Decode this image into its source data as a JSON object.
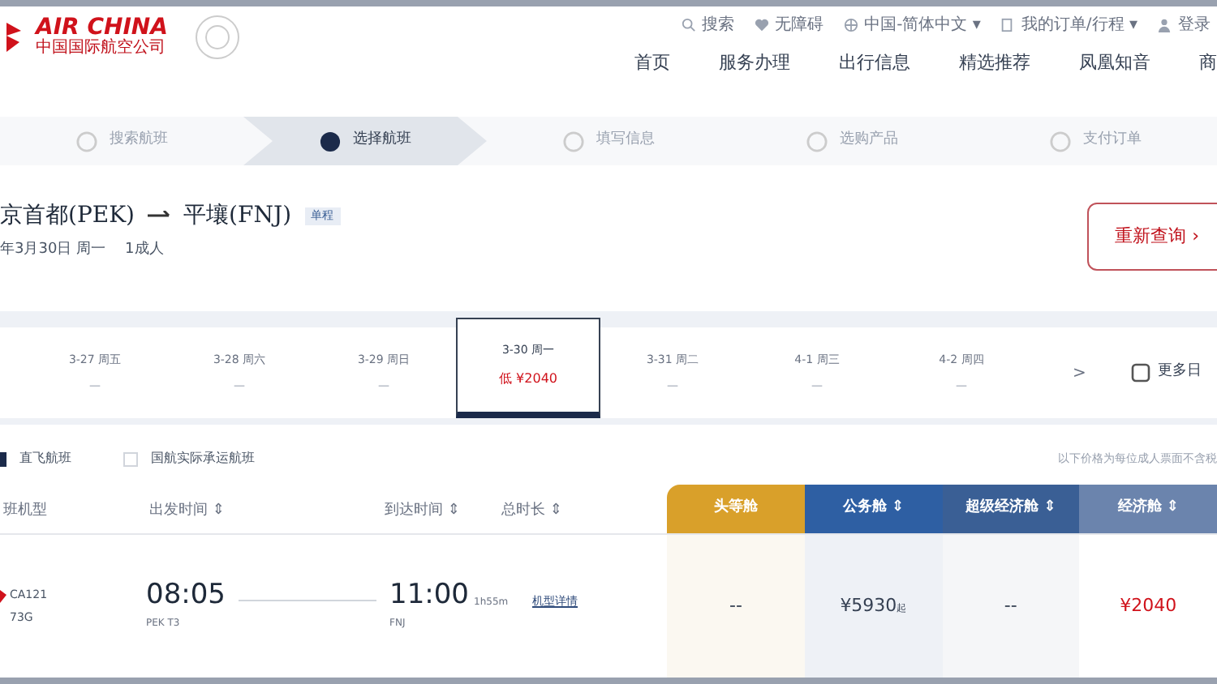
{
  "header": {
    "logo_en": "AIR CHINA",
    "logo_cn": "中国国际航空公司",
    "utility": [
      {
        "kind": "search",
        "label": "搜索"
      },
      {
        "kind": "access",
        "label": "无障碍"
      },
      {
        "kind": "globe",
        "label": "中国-简体中文 ▾"
      },
      {
        "kind": "order",
        "label": "我的订单/行程 ▾"
      },
      {
        "kind": "user",
        "label": "登录"
      }
    ],
    "nav": [
      "首页",
      "服务办理",
      "出行信息",
      "精选推荐",
      "凤凰知音",
      "商"
    ]
  },
  "steps": [
    {
      "label": "搜索航班",
      "selected": false
    },
    {
      "label": "选择航班",
      "selected": true
    },
    {
      "label": "填写信息",
      "selected": false
    },
    {
      "label": "选购产品",
      "selected": false
    },
    {
      "label": "支付订单",
      "selected": false
    }
  ],
  "route": {
    "from": "京首都(PEK)",
    "to": "平壤(FNJ)",
    "badge": "单程",
    "date": "年3月30日 周一",
    "passengers": "1成人",
    "requery": "重新查询",
    "requery_arrow": "›"
  },
  "dates": [
    {
      "date": "3-27 周五",
      "price": "—",
      "selected": false
    },
    {
      "date": "3-28 周六",
      "price": "—",
      "selected": false
    },
    {
      "date": "3-29 周日",
      "price": "—",
      "selected": false
    },
    {
      "date": "3-30 周一",
      "price": "低 ¥2040",
      "selected": true
    },
    {
      "date": "3-31 周二",
      "price": "—",
      "selected": false
    },
    {
      "date": "4-1 周三",
      "price": "—",
      "selected": false
    },
    {
      "date": "4-2 周四",
      "price": "—",
      "selected": false
    }
  ],
  "date_next": ">",
  "more_dates": "更多日",
  "filters": [
    {
      "label": "直飞航班",
      "checked": true
    },
    {
      "label": "国航实际承运航班",
      "checked": false
    }
  ],
  "price_note": "以下价格为每位成人票面不含税",
  "columns": [
    "班机型",
    "出发时间 ⇕",
    "到达时间 ⇕",
    "总时长 ⇕"
  ],
  "cabins": [
    {
      "label": "头等舱",
      "color": "#d9a02a"
    },
    {
      "label": "公务舱 ⇕",
      "color": "#2e5fa3"
    },
    {
      "label": "超级经济舱 ⇕",
      "color": "#3a5f95"
    },
    {
      "label": "经济舱 ⇕",
      "color": "#6b84ad"
    }
  ],
  "flight": {
    "number": "CA121",
    "aircraft": "73G",
    "dep_time": "08:05",
    "dep_airport": "PEK T3",
    "arr_time": "11:00",
    "arr_airport": "FNJ",
    "duration": "1h55m",
    "details": "机型详情",
    "prices": [
      {
        "value": "--",
        "lowest": false
      },
      {
        "value": "¥5930",
        "suffix": "起",
        "lowest": false
      },
      {
        "value": "--",
        "lowest": false
      },
      {
        "value": "¥2040",
        "lowest": true
      }
    ]
  }
}
